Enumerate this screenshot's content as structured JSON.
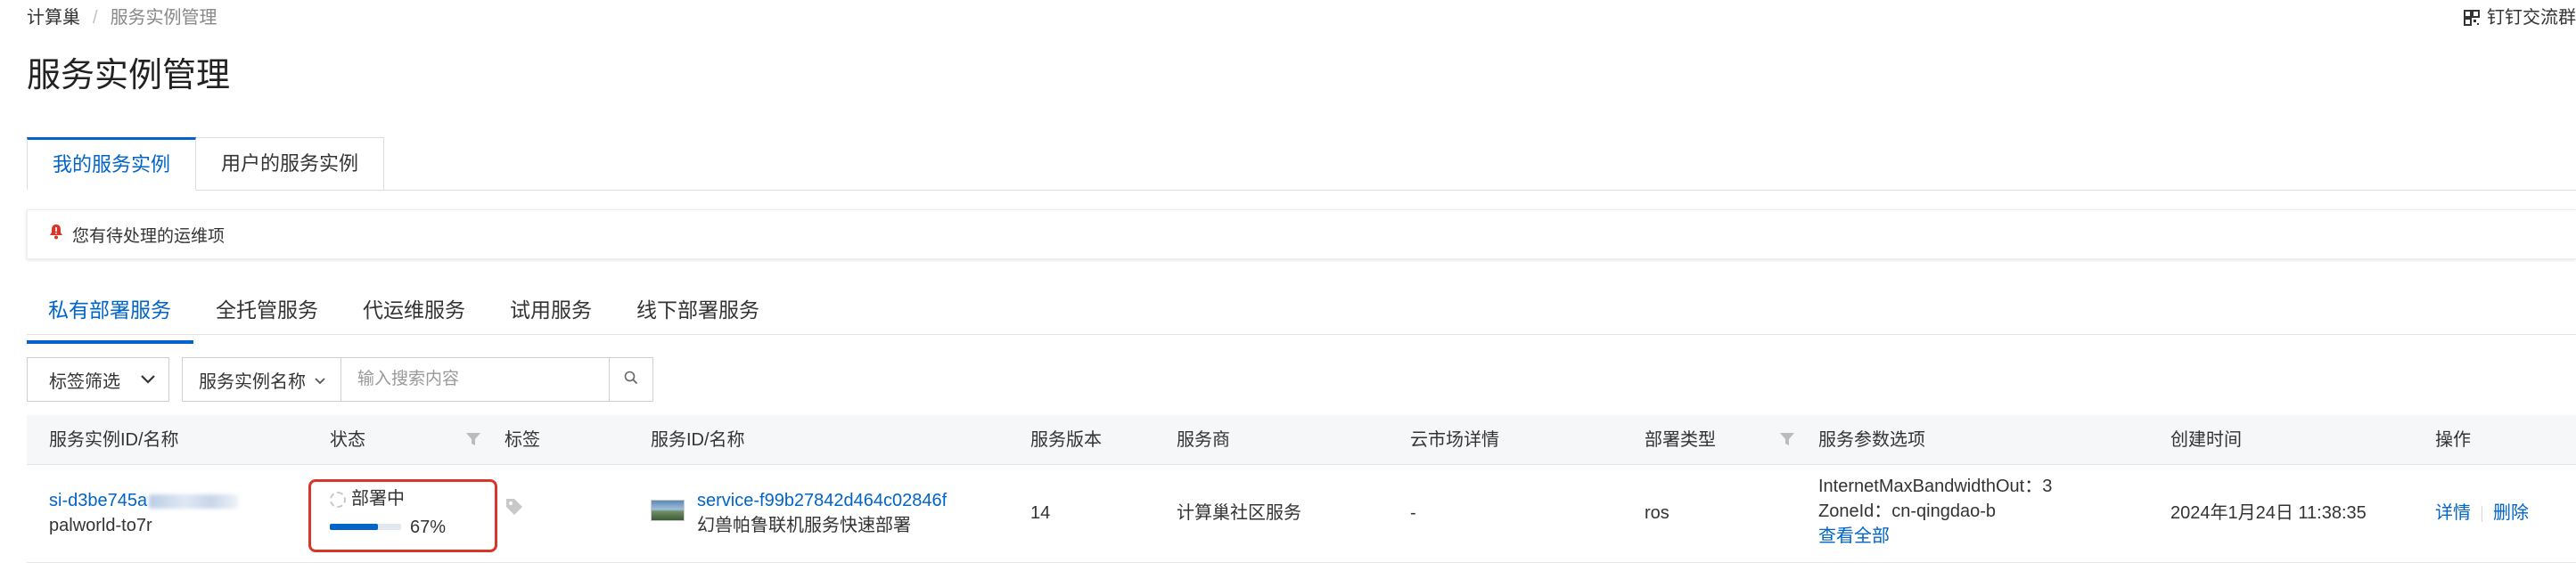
{
  "breadcrumb": {
    "root": "计算巢",
    "separator": "/",
    "current": "服务实例管理"
  },
  "header": {
    "dingtalk_label": "钉钉交流群"
  },
  "page": {
    "title": "服务实例管理"
  },
  "primary_tabs": [
    {
      "label": "我的服务实例",
      "active": true
    },
    {
      "label": "用户的服务实例",
      "active": false
    }
  ],
  "alert": {
    "text": "您有待处理的运维项"
  },
  "secondary_tabs": [
    {
      "label": "私有部署服务",
      "active": true
    },
    {
      "label": "全托管服务",
      "active": false
    },
    {
      "label": "代运维服务",
      "active": false
    },
    {
      "label": "试用服务",
      "active": false
    },
    {
      "label": "线下部署服务",
      "active": false
    }
  ],
  "filters": {
    "tag_filter_label": "标签筛选",
    "search_field_label": "服务实例名称",
    "search_placeholder": "输入搜索内容"
  },
  "table": {
    "columns": [
      "服务实例ID/名称",
      "状态",
      "标签",
      "服务ID/名称",
      "服务版本",
      "服务商",
      "云市场详情",
      "部署类型",
      "服务参数选项",
      "创建时间",
      "操作"
    ],
    "rows": [
      {
        "instance_id": "si-d3be745a",
        "instance_name": "palworld-to7r",
        "status": "部署中",
        "progress_percent": 67,
        "progress_label": "67%",
        "service_id": "service-f99b27842d464c02846f",
        "service_name": "幻兽帕鲁联机服务快速部署",
        "version": "14",
        "provider": "计算巢社区服务",
        "market_detail": "-",
        "deploy_type": "ros",
        "params": [
          "InternetMaxBandwidthOut：3",
          "ZoneId：cn-qingdao-b"
        ],
        "params_more": "查看全部",
        "created_at": "2024年1月24日 11:38:35",
        "actions": {
          "detail": "详情",
          "delete": "删除"
        }
      }
    ]
  },
  "colors": {
    "primary": "#0064c8",
    "highlight_border": "#d9362b",
    "alert_icon": "#d9362b"
  }
}
